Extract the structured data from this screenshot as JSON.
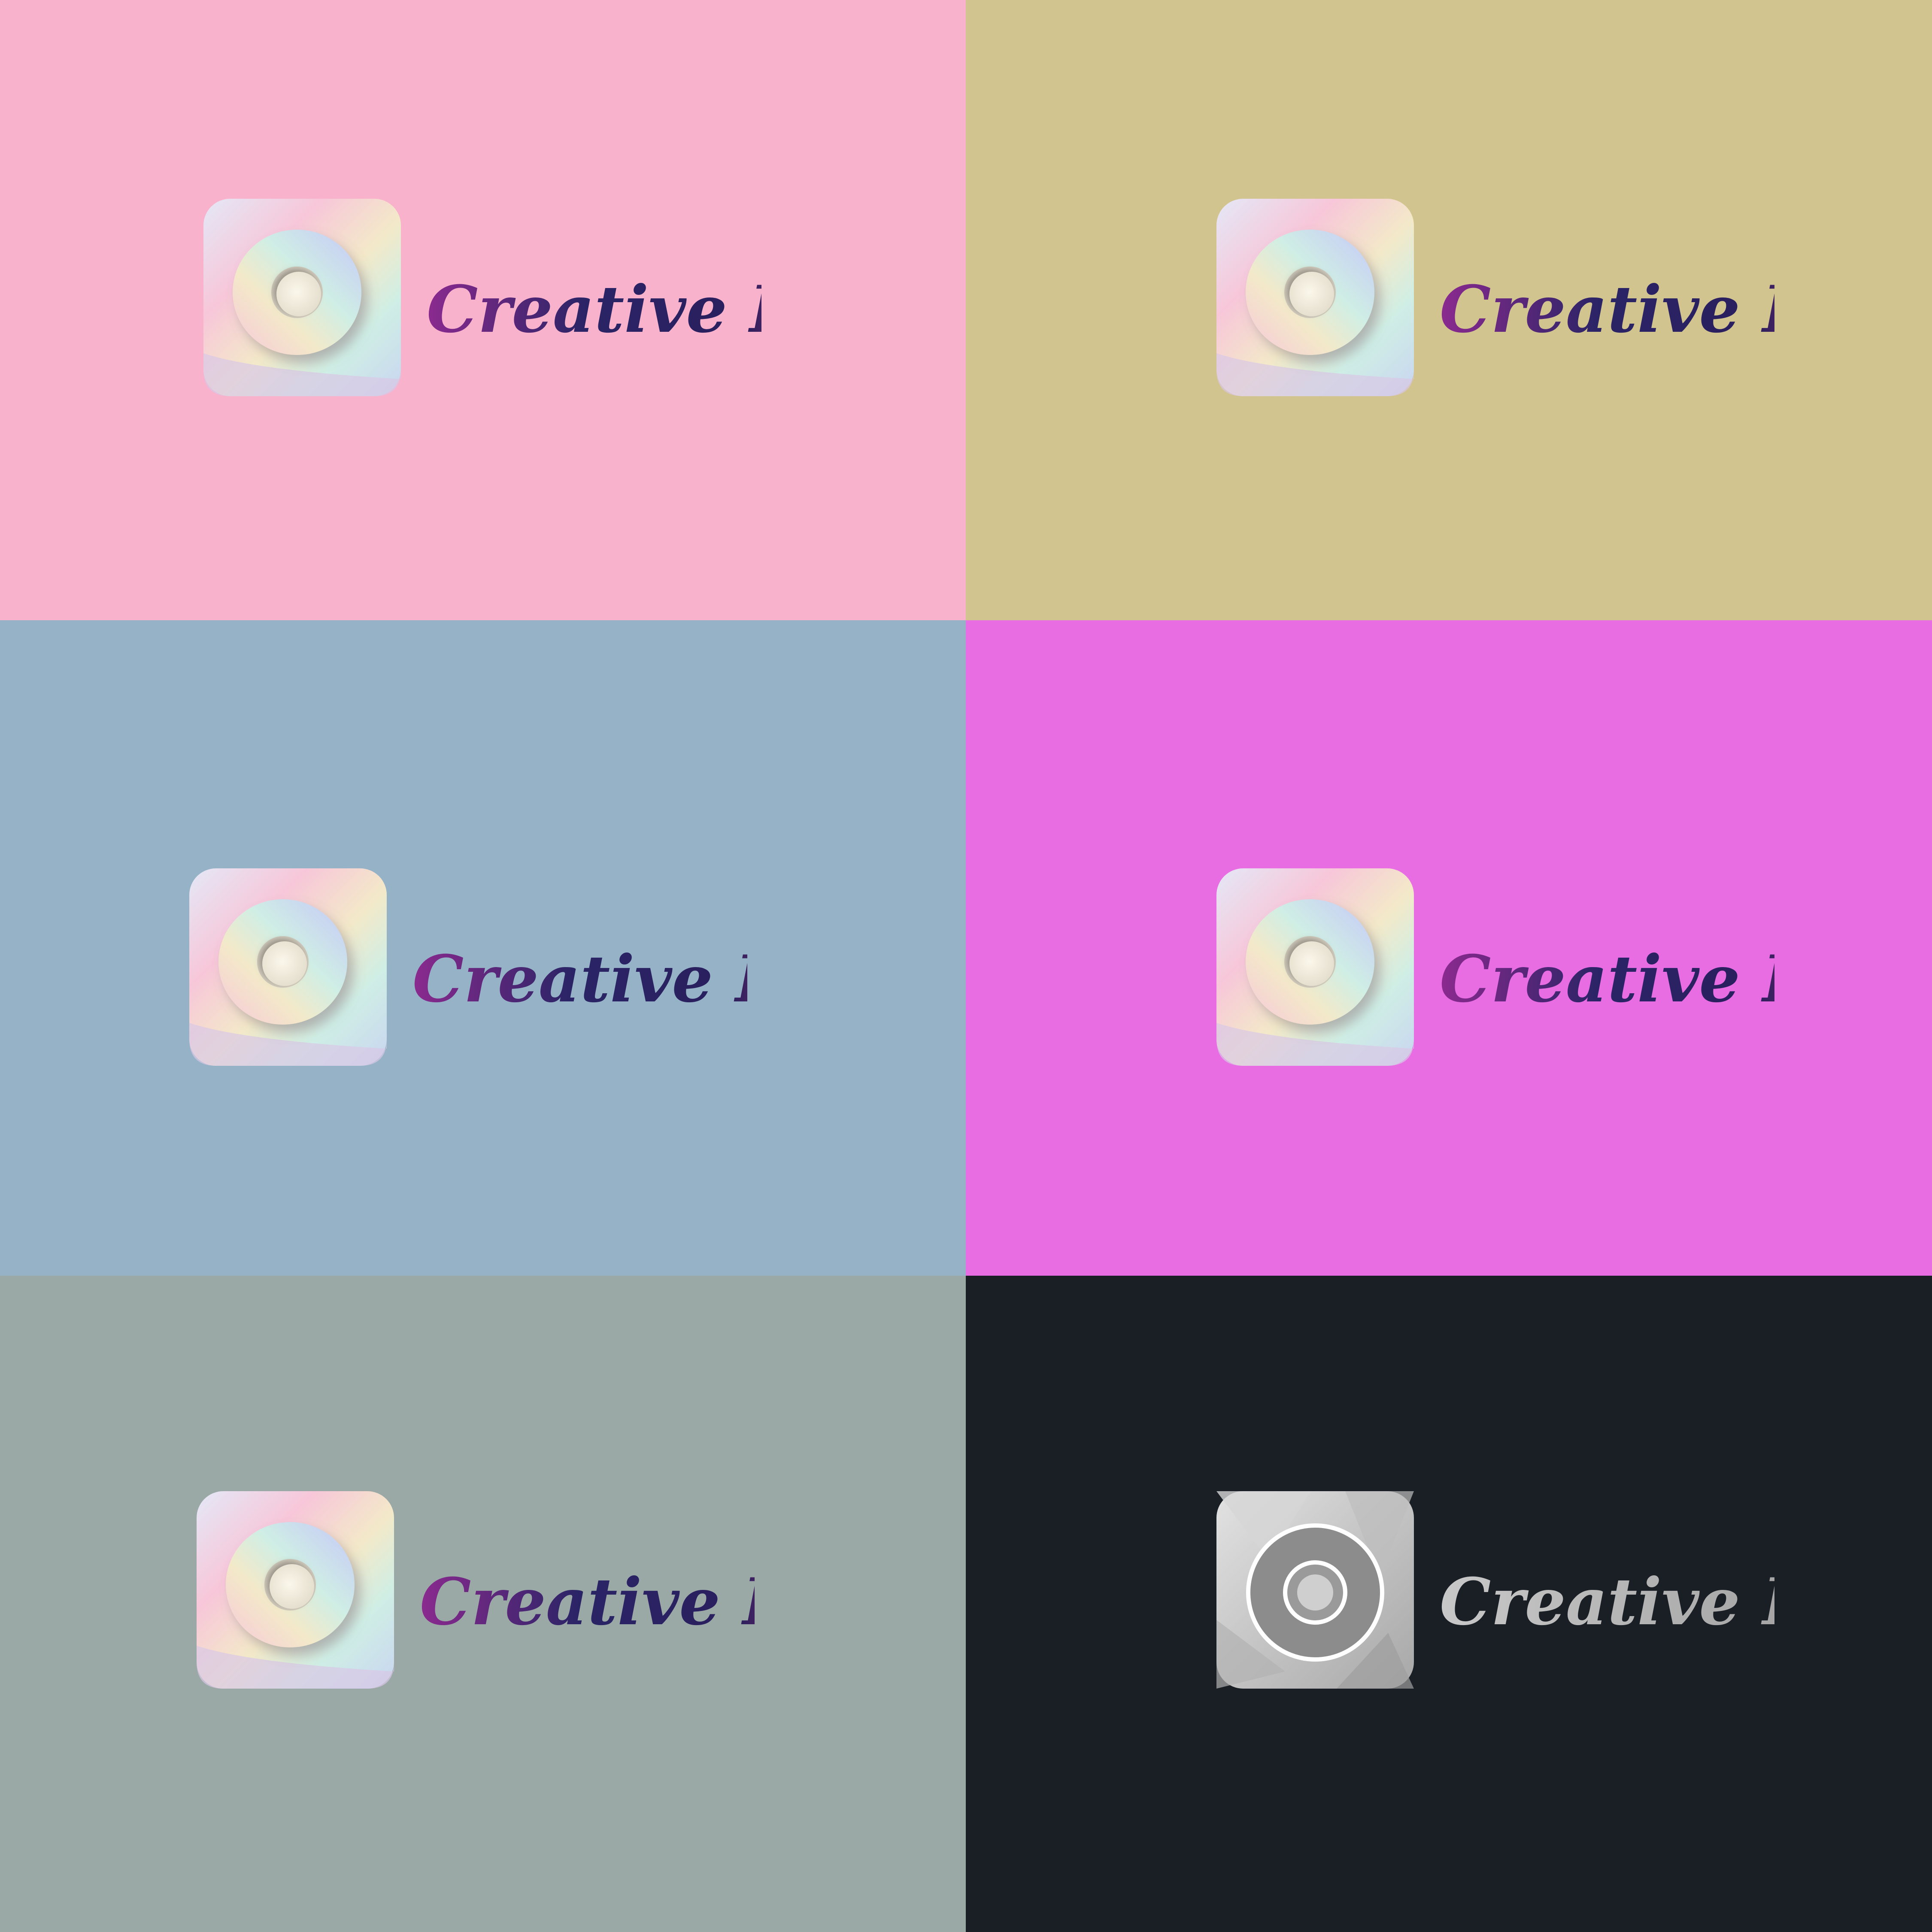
{
  "brand": {
    "name": "Creative Lab",
    "name_part_1": "Creative",
    "name_part_2": "Lab"
  },
  "panels": [
    {
      "background": "#f9b2cc",
      "icon_style": "holographic",
      "text_style": "gradient"
    },
    {
      "background": "#d1c48f",
      "icon_style": "holographic",
      "text_style": "gradient"
    },
    {
      "background": "#95b2c7",
      "icon_style": "holographic",
      "text_style": "gradient"
    },
    {
      "background": "#e86ce2",
      "icon_style": "holographic",
      "text_style": "gradient"
    },
    {
      "background": "#9aa8a6",
      "icon_style": "holographic",
      "text_style": "gradient"
    },
    {
      "background": "#1a1f26",
      "icon_style": "grayscale",
      "text_style": "gray"
    }
  ],
  "colors": {
    "text_gradient": [
      "#8b2a8f",
      "#2a2466",
      "#2a1f5e",
      "#e0337a"
    ],
    "text_gray": [
      "#c8c8c8",
      "#9a9a9a"
    ],
    "holo": [
      "#f7c7d9",
      "#e4e8f7",
      "#cfeee5",
      "#f3e9c9",
      "#c9d5f1"
    ]
  },
  "icons": {
    "mark": "lens-ring-icon"
  }
}
